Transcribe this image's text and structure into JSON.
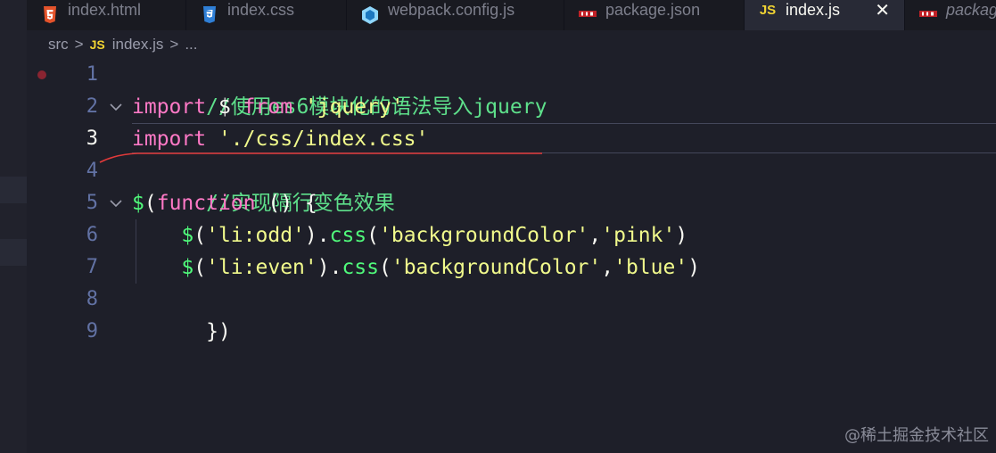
{
  "tabs": [
    {
      "label": "index.html",
      "icon": "html5-icon"
    },
    {
      "label": "index.css",
      "icon": "css3-icon"
    },
    {
      "label": "webpack.config.js",
      "icon": "webpack-icon"
    },
    {
      "label": "package.json",
      "icon": "npm-icon"
    },
    {
      "label": "index.js",
      "icon": "js-icon",
      "active": true,
      "close": "✕"
    },
    {
      "label": "packag",
      "icon": "npm-icon"
    }
  ],
  "breadcrumb": {
    "folder": "src",
    "sep": ">",
    "js_badge": "JS",
    "file": "index.js",
    "more": "..."
  },
  "editor": {
    "line_numbers": [
      "1",
      "2",
      "3",
      "4",
      "5",
      "6",
      "7",
      "8",
      "9"
    ],
    "lines": {
      "l1": {
        "comment": "//使用es6模块化的语法导入jquery"
      },
      "l2": {
        "kw_import": "import",
        "sp1": " ",
        "dollar": "$",
        "sp2": " ",
        "kw_from": "from",
        "sp3": " ",
        "str": "'jquery'"
      },
      "l3": {
        "kw_import": "import",
        "sp1": " ",
        "str": "'./css/index.css'"
      },
      "l4": {
        "comment": "//实现隔行变色效果"
      },
      "l5": {
        "dollar": "$",
        "paren_open": "(",
        "kw_function": "function",
        "rest": " () {"
      },
      "l6": {
        "indent": "    ",
        "dollar": "$",
        "p1": "(",
        "str1": "'li:odd'",
        "p2": ").",
        "method": "css",
        "p3": "(",
        "str2": "'backgroundColor'",
        "comma": ",",
        "str3": "'pink'",
        "p4": ")"
      },
      "l7": {
        "indent": "    ",
        "dollar": "$",
        "p1": "(",
        "str1": "'li:even'",
        "p2": ").",
        "method": "css",
        "p3": "(",
        "str2": "'backgroundColor'",
        "comma": ",",
        "str3": "'blue'",
        "p4": ")"
      },
      "l8": {
        "text": "})"
      }
    }
  },
  "watermark": "@稀土掘金技术社区",
  "colors": {
    "comment": "#5ee08b",
    "keyword": "#ff79c6",
    "function": "#50fa7b",
    "string": "#f1fa8c",
    "text": "#f8f8f2",
    "annotation": "#e23a3a"
  }
}
